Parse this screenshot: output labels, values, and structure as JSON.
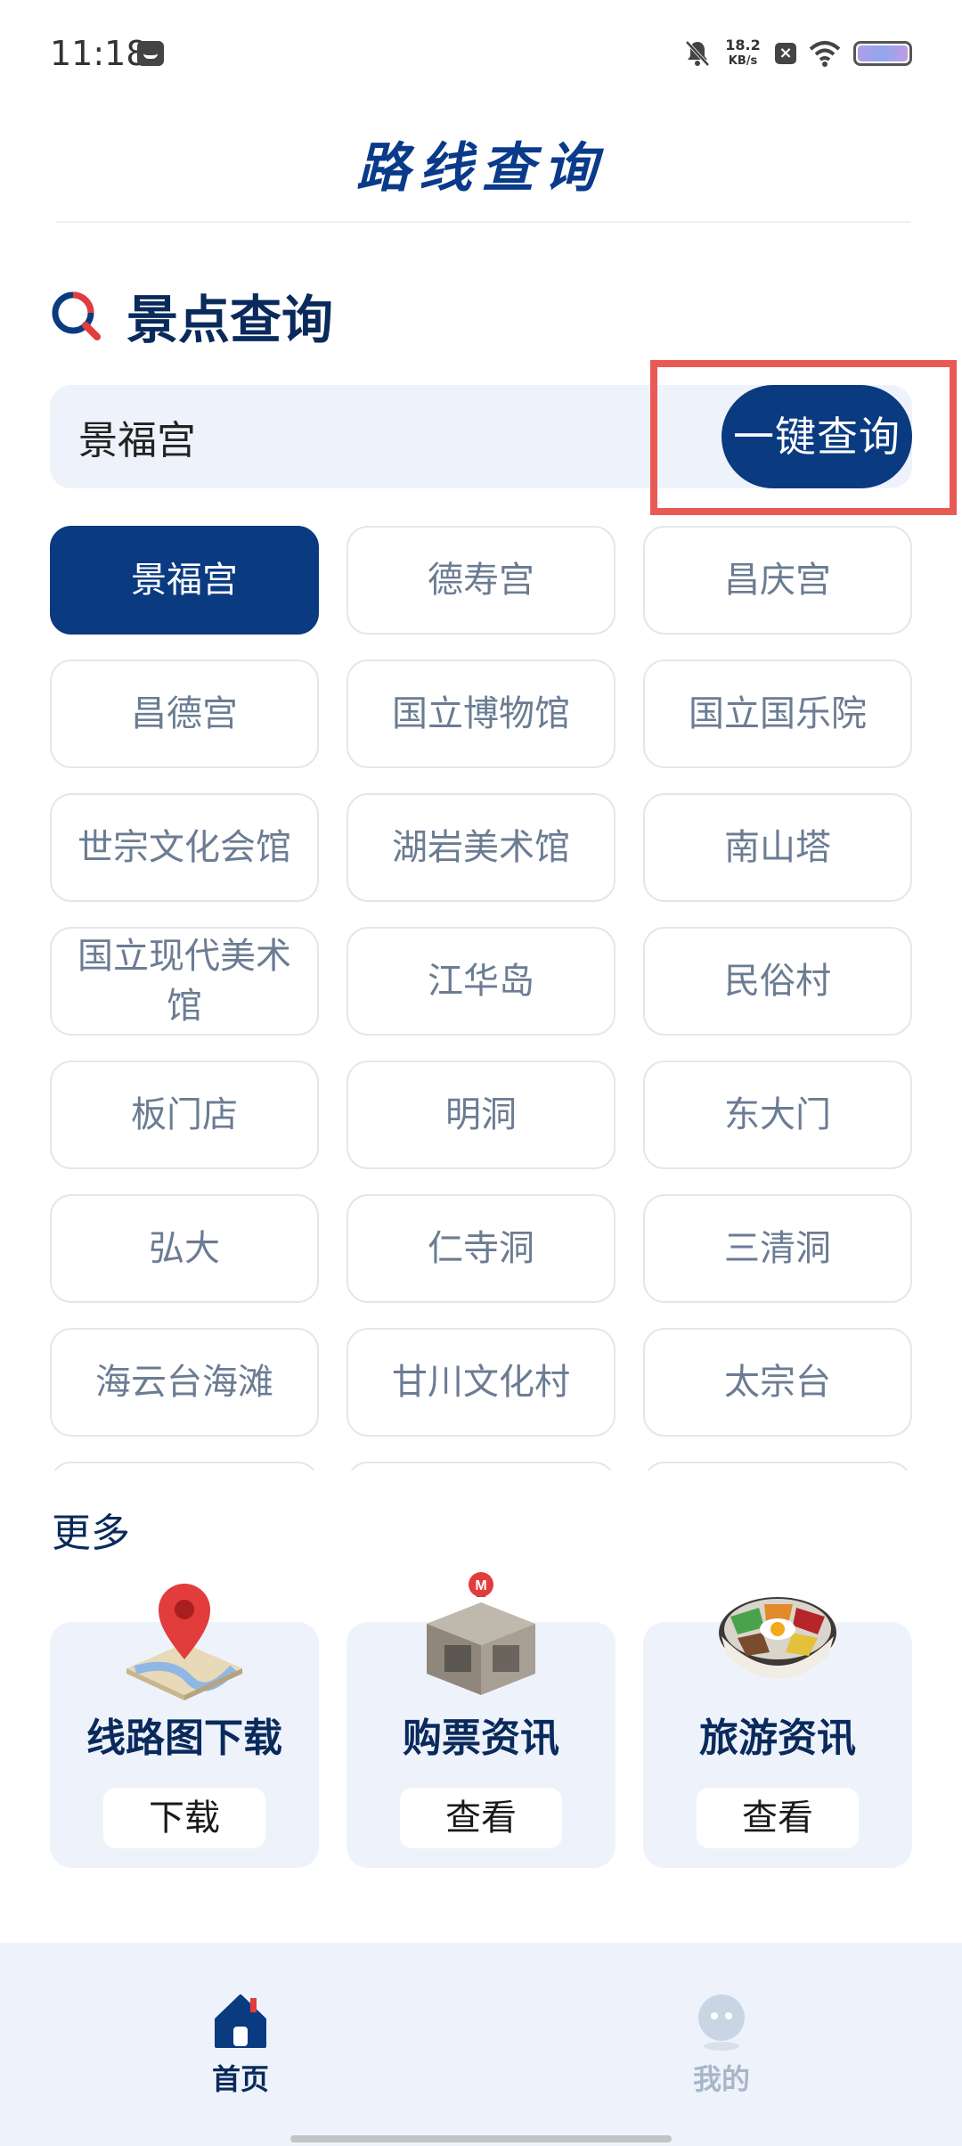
{
  "status_bar": {
    "time": "11:18",
    "net_speed_value": "18.2",
    "net_speed_unit": "KB/s",
    "icons": [
      "message-icon",
      "bell-off-icon",
      "close-box-icon",
      "wifi-icon",
      "battery-icon"
    ]
  },
  "header": {
    "title": "路线查询"
  },
  "search_section": {
    "title": "景点查询",
    "input_value": "景福宫",
    "button_label": "一键查询"
  },
  "chips": [
    {
      "label": "景福宫",
      "selected": true
    },
    {
      "label": "德寿宫",
      "selected": false
    },
    {
      "label": "昌庆宫",
      "selected": false
    },
    {
      "label": "昌德宫",
      "selected": false
    },
    {
      "label": "国立博物馆",
      "selected": false
    },
    {
      "label": "国立国乐院",
      "selected": false
    },
    {
      "label": "世宗文化会馆",
      "selected": false
    },
    {
      "label": "湖岩美术馆",
      "selected": false
    },
    {
      "label": "南山塔",
      "selected": false
    },
    {
      "label": "国立现代美术馆",
      "selected": false
    },
    {
      "label": "江华岛",
      "selected": false
    },
    {
      "label": "民俗村",
      "selected": false
    },
    {
      "label": "板门店",
      "selected": false
    },
    {
      "label": "明洞",
      "selected": false
    },
    {
      "label": "东大门",
      "selected": false
    },
    {
      "label": "弘大",
      "selected": false
    },
    {
      "label": "仁寺洞",
      "selected": false
    },
    {
      "label": "三清洞",
      "selected": false
    },
    {
      "label": "海云台海滩",
      "selected": false
    },
    {
      "label": "甘川文化村",
      "selected": false
    },
    {
      "label": "太宗台",
      "selected": false
    },
    {
      "label": "",
      "selected": false
    },
    {
      "label": "",
      "selected": false
    },
    {
      "label": "",
      "selected": false
    }
  ],
  "more": {
    "title": "更多",
    "cards": [
      {
        "title": "线路图下载",
        "button": "下载",
        "icon": "map-pin-icon"
      },
      {
        "title": "购票资讯",
        "button": "查看",
        "icon": "metro-gate-icon"
      },
      {
        "title": "旅游资讯",
        "button": "查看",
        "icon": "bibimbap-icon"
      }
    ]
  },
  "bottom_nav": {
    "items": [
      {
        "label": "首页",
        "icon": "home-icon",
        "active": true
      },
      {
        "label": "我的",
        "icon": "profile-icon",
        "active": false
      }
    ]
  },
  "colors": {
    "primary": "#0a3a80",
    "chip_text": "#6b7c93",
    "panel_bg": "#eef3fb",
    "highlight": "#ea5a55"
  }
}
